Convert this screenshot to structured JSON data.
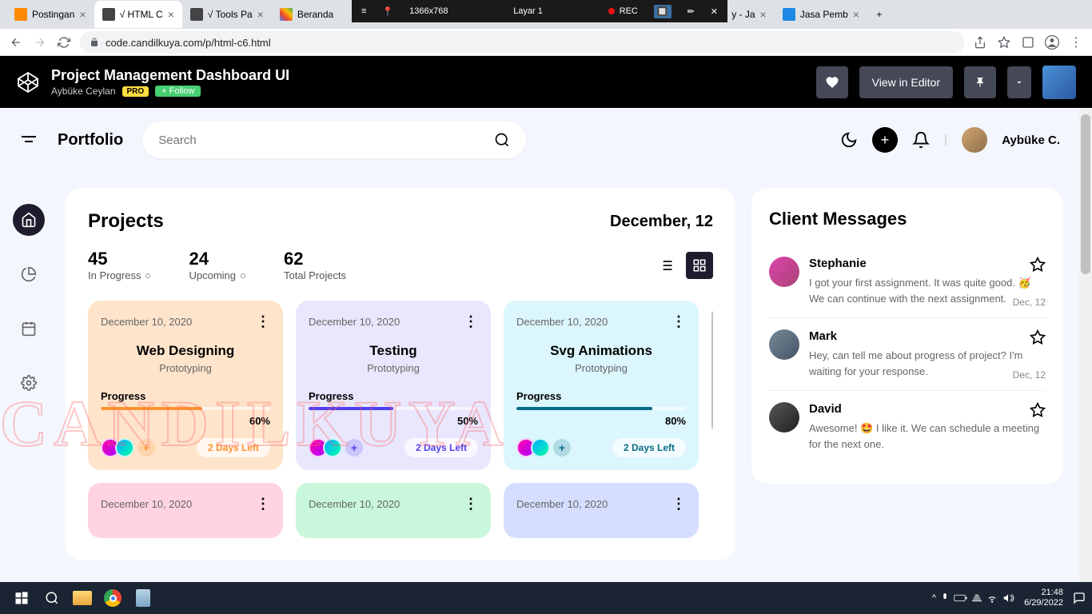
{
  "browser": {
    "tabs": [
      {
        "title": "Postingan"
      },
      {
        "title": "√ HTML C"
      },
      {
        "title": "√ Tools Pa"
      },
      {
        "title": "Beranda"
      },
      {
        "title": "y - Ja"
      },
      {
        "title": "Jasa Pemb"
      }
    ],
    "url": "code.candilkuya.com/p/html-c6.html"
  },
  "recorder": {
    "resolution": "1366x768",
    "layer": "Layar 1",
    "status": "REC"
  },
  "codepen": {
    "title": "Project Management Dashboard UI",
    "author": "Aybüke Ceylan",
    "pro": "PRO",
    "follow": "+ Follow",
    "view_btn": "View in Editor"
  },
  "app": {
    "portfolio": "Portfolio",
    "search_placeholder": "Search",
    "user": "Aybüke C."
  },
  "projects": {
    "title": "Projects",
    "date": "December, 12",
    "stats": [
      {
        "num": "45",
        "label": "In Progress"
      },
      {
        "num": "24",
        "label": "Upcoming"
      },
      {
        "num": "62",
        "label": "Total Projects"
      }
    ],
    "cards": [
      {
        "date": "December 10, 2020",
        "title": "Web Designing",
        "sub": "Prototyping",
        "prog_label": "Progress",
        "pct": "60%",
        "pct_w": 60,
        "days": "2 Days Left",
        "cls": "orange"
      },
      {
        "date": "December 10, 2020",
        "title": "Testing",
        "sub": "Prototyping",
        "prog_label": "Progress",
        "pct": "50%",
        "pct_w": 50,
        "days": "2 Days Left",
        "cls": "purple"
      },
      {
        "date": "December 10, 2020",
        "title": "Svg Animations",
        "sub": "Prototyping",
        "prog_label": "Progress",
        "pct": "80%",
        "pct_w": 80,
        "days": "2 Days Left",
        "cls": "cyan"
      },
      {
        "date": "December 10, 2020",
        "cls": "pink"
      },
      {
        "date": "December 10, 2020",
        "cls": "green"
      },
      {
        "date": "December 10, 2020",
        "cls": "blue"
      }
    ]
  },
  "messages": {
    "title": "Client Messages",
    "items": [
      {
        "name": "Stephanie",
        "text": "I got your first assignment. It was quite good. 🥳 We can continue with the next assignment.",
        "date": "Dec, 12"
      },
      {
        "name": "Mark",
        "text": "Hey, can tell me about progress of project? I'm waiting for your response.",
        "date": "Dec, 12"
      },
      {
        "name": "David",
        "text": "Awesome! 🤩 I like it. We can schedule a meeting for the next one.",
        "date": ""
      }
    ]
  },
  "watermark": "CANDILKUYA",
  "taskbar": {
    "time": "21:48",
    "date": "6/29/2022"
  }
}
